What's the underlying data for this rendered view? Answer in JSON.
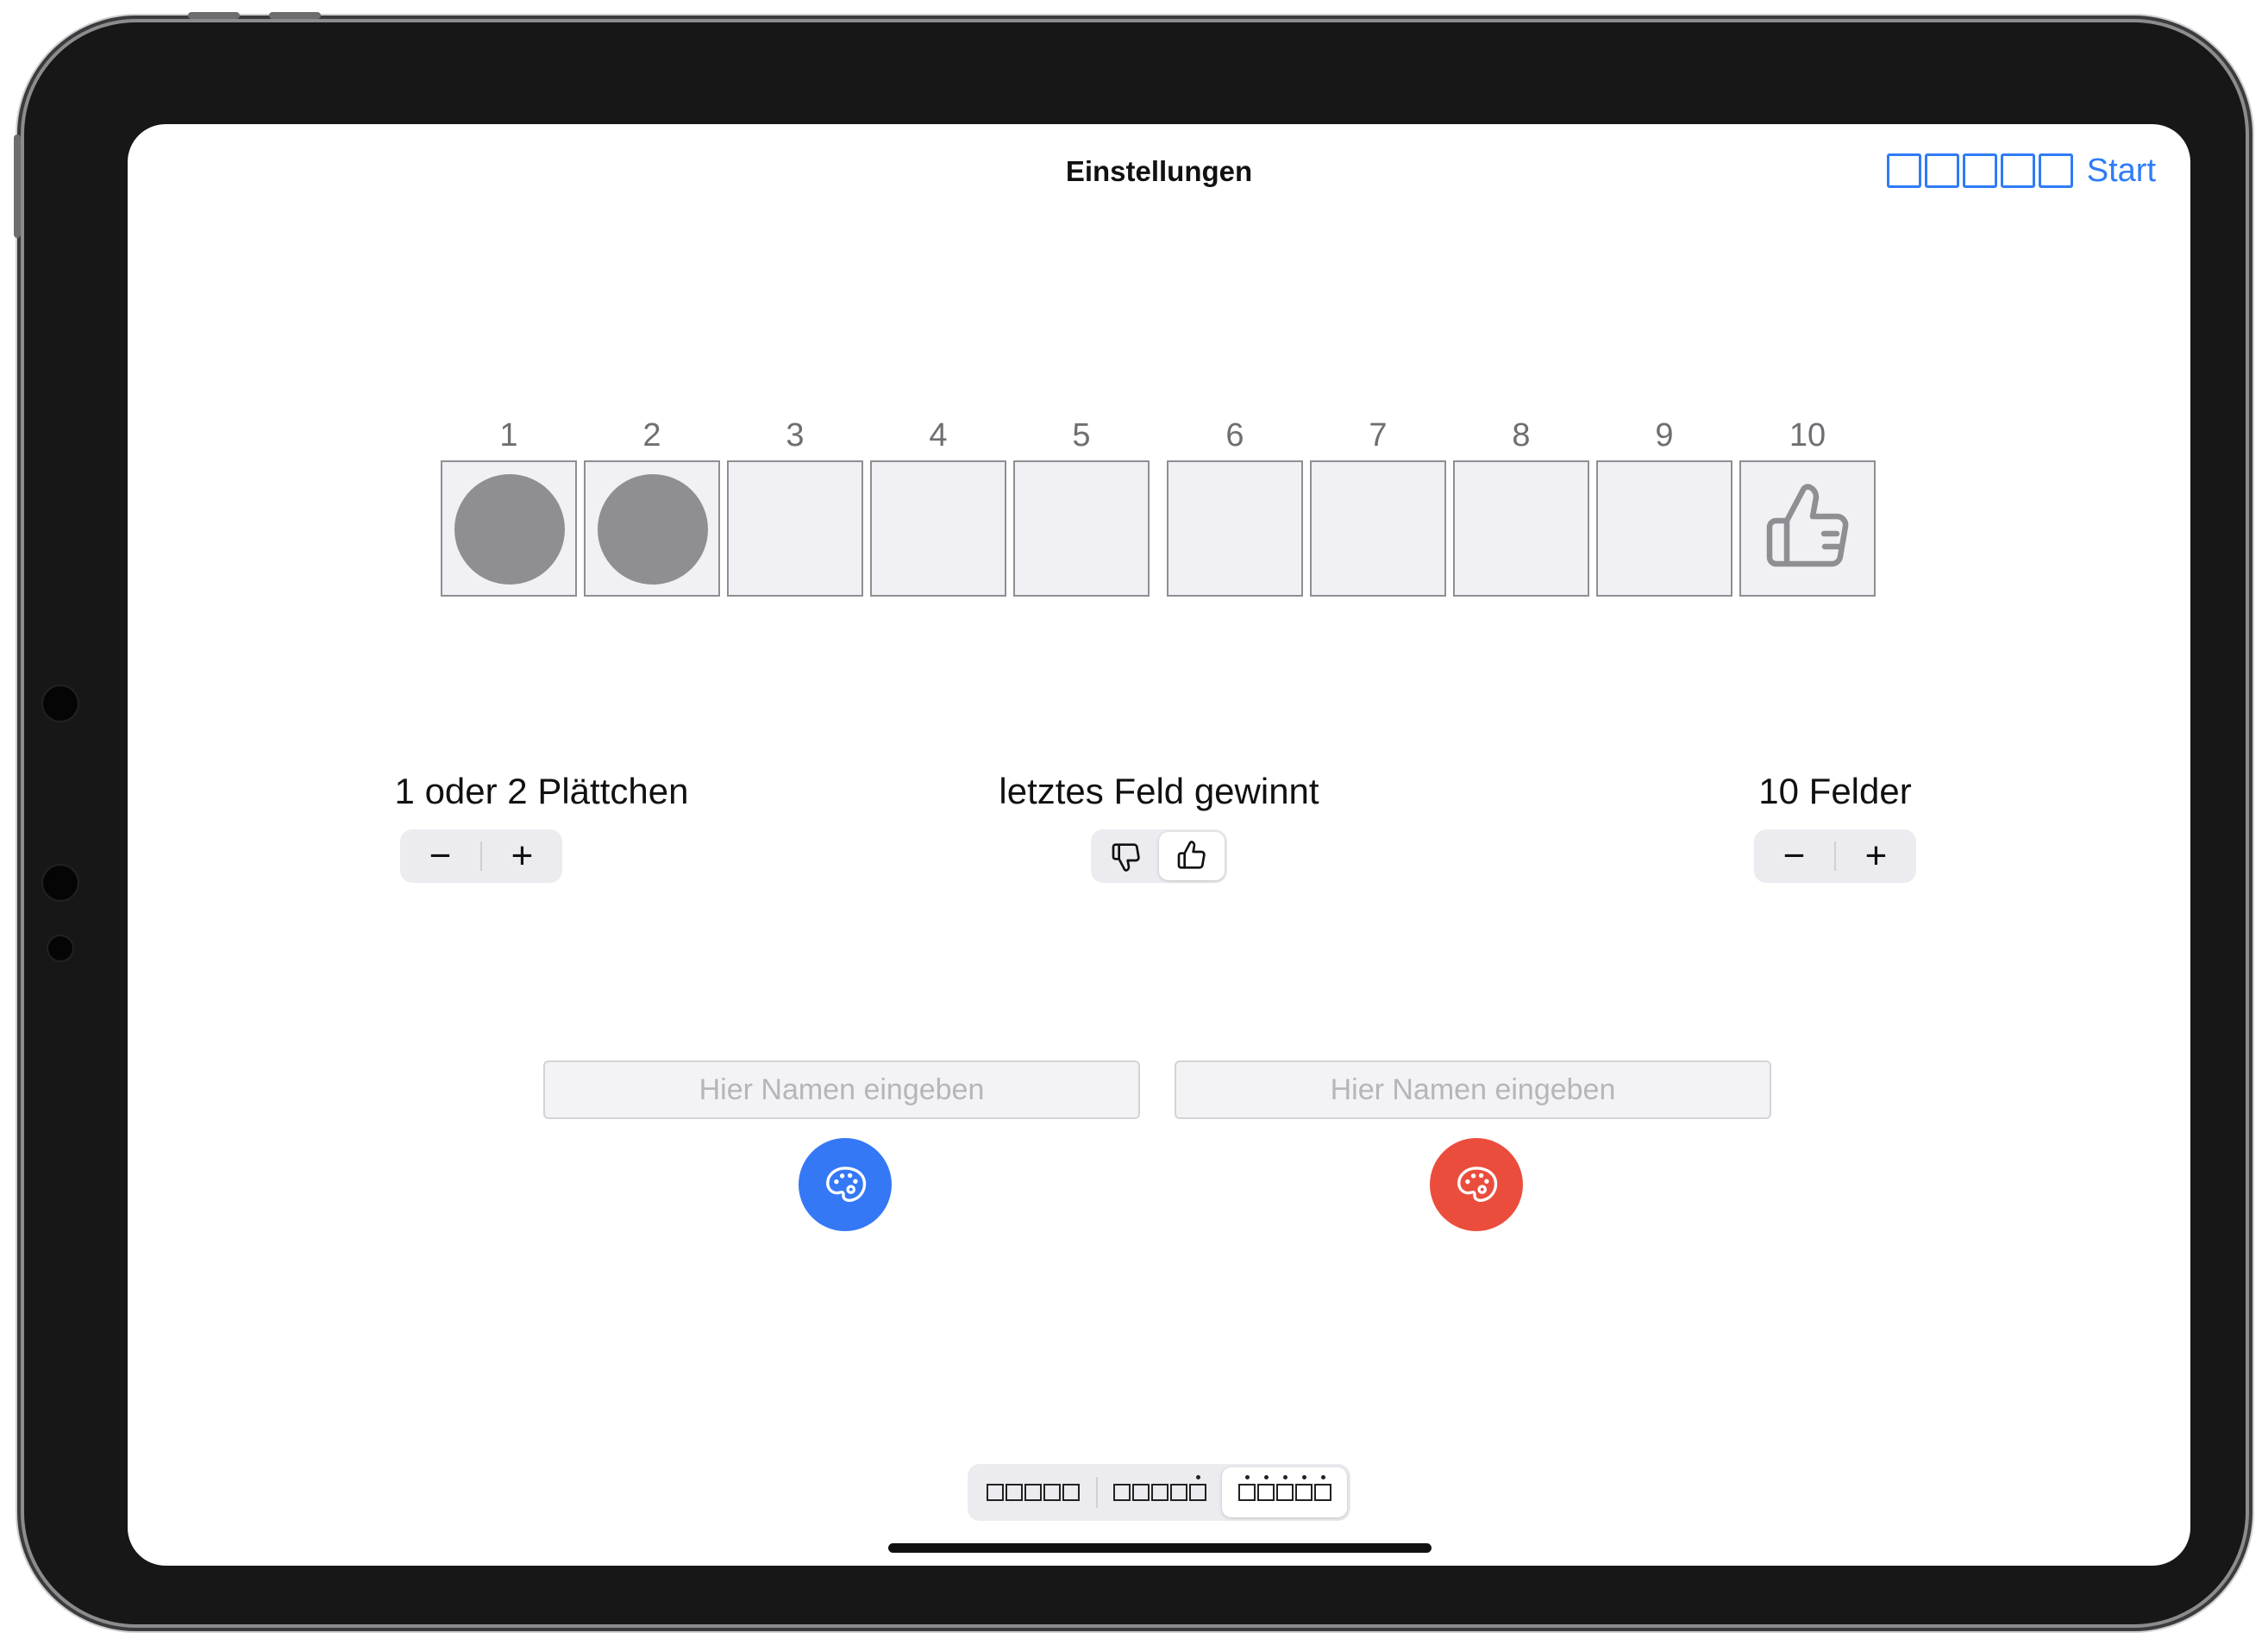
{
  "nav": {
    "title": "Einstellungen",
    "start_label": "Start",
    "start_icon": "five-empty-boxes-icon"
  },
  "board": {
    "cells": [
      {
        "number": "1",
        "content": "token"
      },
      {
        "number": "2",
        "content": "token"
      },
      {
        "number": "3",
        "content": "empty"
      },
      {
        "number": "4",
        "content": "empty"
      },
      {
        "number": "5",
        "content": "empty"
      },
      {
        "number": "6",
        "content": "empty"
      },
      {
        "number": "7",
        "content": "empty"
      },
      {
        "number": "8",
        "content": "empty"
      },
      {
        "number": "9",
        "content": "empty"
      },
      {
        "number": "10",
        "content": "thumbs-up-icon"
      }
    ]
  },
  "settings": {
    "tiles_label": "1 oder 2 Plättchen",
    "tiles_minus": "−",
    "tiles_plus": "+",
    "win_label": "letztes Feld gewinnt",
    "win_options": [
      "thumbs-down-icon",
      "thumbs-up-icon"
    ],
    "win_selected": "thumbs-up-icon",
    "fields_label": "10 Felder",
    "fields_minus": "−",
    "fields_plus": "+"
  },
  "players": [
    {
      "placeholder": "Hier Namen eingeben",
      "value": "",
      "color": "#3478f6",
      "icon": "palette-icon"
    },
    {
      "placeholder": "Hier Namen eingeben",
      "value": "",
      "color": "#eb4d3d",
      "icon": "palette-icon"
    }
  ],
  "mode_selector": {
    "options": [
      "five-boxes-icon",
      "five-boxes-one-dot-icon",
      "five-boxes-five-dots-icon"
    ],
    "selected_index": 2
  },
  "colors": {
    "accent": "#2f7cf6",
    "token": "#8e8e93",
    "cell_bg": "#f1f1f5"
  }
}
